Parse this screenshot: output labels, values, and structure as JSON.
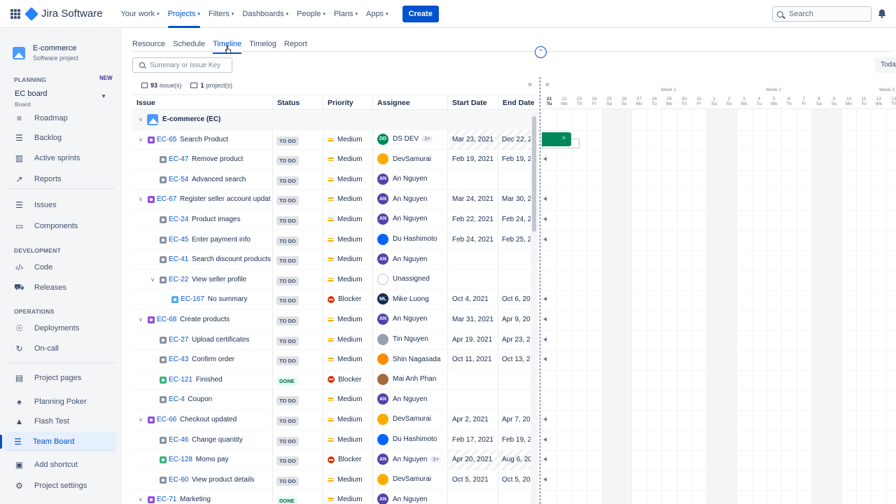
{
  "topnav": {
    "app_name": "Jira Software",
    "items": [
      {
        "label": "Your work",
        "active": false
      },
      {
        "label": "Projects",
        "active": true
      },
      {
        "label": "Filters",
        "active": false
      },
      {
        "label": "Dashboards",
        "active": false
      },
      {
        "label": "People",
        "active": false
      },
      {
        "label": "Plans",
        "active": false
      },
      {
        "label": "Apps",
        "active": false
      }
    ],
    "create_label": "Create",
    "search_placeholder": "Search"
  },
  "sidebar": {
    "project_name": "E-commerce",
    "project_type": "Software project",
    "planning_label": "PLANNING",
    "new_badge": "NEW",
    "board_name": "EC board",
    "board_sub": "Board",
    "planning_items": [
      "Roadmap",
      "Backlog",
      "Active sprints",
      "Reports"
    ],
    "other_items": [
      "Issues",
      "Components"
    ],
    "development_label": "DEVELOPMENT",
    "development_items": [
      "Code",
      "Releases"
    ],
    "operations_label": "OPERATIONS",
    "operations_items": [
      "Deployments",
      "On-call"
    ],
    "bottom_items": [
      "Project pages",
      "Planning Poker",
      "Flash Test",
      "Team Board"
    ],
    "active_item": "Team Board",
    "add_shortcut": "Add shortcut",
    "project_settings": "Project settings"
  },
  "tabs": [
    "Resource",
    "Schedule",
    "Timeline",
    "Timelog",
    "Report"
  ],
  "active_tab": "Timeline",
  "issue_search_placeholder": "Summary or Issue Key",
  "today_label": "Toda",
  "counts": {
    "issues": "93",
    "issues_label": "issue(s)",
    "projects": "1",
    "projects_label": "project(s)"
  },
  "columns": [
    "Issue",
    "Status",
    "Priority",
    "Assignee",
    "Start Date",
    "End Date"
  ],
  "rows": [
    {
      "type": "group",
      "key": "",
      "summary": "E-commerce",
      "suffix": "(EC)"
    },
    {
      "type": "epic",
      "level": 1,
      "caret": true,
      "key": "EC-65",
      "summary": "Search Product",
      "status": "TO DO",
      "priority": "Medium",
      "assignee": "DS DEV",
      "avatar": "DD",
      "avatar_color": "#00875a",
      "extra": "1+",
      "start": "Mar 23, 2021",
      "end": "Dec 22, 2",
      "hatch": true
    },
    {
      "type": "sub",
      "level": 2,
      "key": "EC-47",
      "summary": "Remove product",
      "status": "TO DO",
      "priority": "Medium",
      "assignee": "DevSamurai",
      "avatar": "",
      "avatar_color": "#ffab00",
      "start": "Feb 19, 2021",
      "end": "Feb 19, 2"
    },
    {
      "type": "sub",
      "level": 2,
      "key": "EC-54",
      "summary": "Advanced search",
      "status": "TO DO",
      "priority": "Medium",
      "assignee": "An Nguyen",
      "avatar": "AN",
      "avatar_color": "#5243aa",
      "start": "",
      "end": ""
    },
    {
      "type": "epic",
      "level": 1,
      "caret": true,
      "key": "EC-67",
      "summary": "Register seller account update",
      "status": "TO DO",
      "priority": "Medium",
      "assignee": "An Nguyen",
      "avatar": "AN",
      "avatar_color": "#5243aa",
      "start": "Mar 24, 2021",
      "end": "Mar 30, 2"
    },
    {
      "type": "sub",
      "level": 2,
      "key": "EC-24",
      "summary": "Product images",
      "status": "TO DO",
      "priority": "Medium",
      "assignee": "An Nguyen",
      "avatar": "AN",
      "avatar_color": "#5243aa",
      "start": "Feb 22, 2021",
      "end": "Feb 24, 2"
    },
    {
      "type": "sub",
      "level": 2,
      "key": "EC-45",
      "summary": "Enter payment info",
      "status": "TO DO",
      "priority": "Medium",
      "assignee": "Du Hashimoto",
      "avatar": "",
      "avatar_color": "#0065ff",
      "start": "Feb 24, 2021",
      "end": "Feb 25, 2"
    },
    {
      "type": "sub",
      "level": 2,
      "key": "EC-41",
      "summary": "Search discount products",
      "status": "TO DO",
      "priority": "Medium",
      "assignee": "An Nguyen",
      "avatar": "AN",
      "avatar_color": "#5243aa",
      "start": "",
      "end": ""
    },
    {
      "type": "sub",
      "level": 2,
      "caret": true,
      "key": "EC-22",
      "summary": "View seller profile",
      "status": "TO DO",
      "priority": "Medium",
      "assignee": "Unassigned",
      "avatar": "",
      "avatar_color": "#dfe1e6",
      "start": "",
      "end": ""
    },
    {
      "type": "task",
      "level": 3,
      "key": "EC-167",
      "summary": "No summary",
      "status": "TO DO",
      "priority": "Blocker",
      "assignee": "Mike Luong",
      "avatar": "ML",
      "avatar_color": "#172b4d",
      "start": "Oct 4, 2021",
      "end": "Oct 6, 20"
    },
    {
      "type": "epic",
      "level": 1,
      "caret": true,
      "key": "EC-68",
      "summary": "Create products",
      "status": "TO DO",
      "priority": "Medium",
      "assignee": "An Nguyen",
      "avatar": "AN",
      "avatar_color": "#5243aa",
      "start": "Mar 31, 2021",
      "end": "Apr 9, 20"
    },
    {
      "type": "sub",
      "level": 2,
      "key": "EC-27",
      "summary": "Upload certificates",
      "status": "TO DO",
      "priority": "Medium",
      "assignee": "Tin Nguyen",
      "avatar": "",
      "avatar_color": "#97a0af",
      "start": "Apr 19, 2021",
      "end": "Apr 23, 2"
    },
    {
      "type": "sub",
      "level": 2,
      "key": "EC-43",
      "summary": "Confirm order",
      "status": "TO DO",
      "priority": "Medium",
      "assignee": "Shin Nagasada",
      "avatar": "",
      "avatar_color": "#ff8b00",
      "start": "Oct 11, 2021",
      "end": "Oct 13, 2"
    },
    {
      "type": "story",
      "level": 2,
      "key": "EC-121",
      "summary": "Finished",
      "status": "DONE",
      "priority": "Blocker",
      "assignee": "Mai Anh Phan",
      "avatar": "",
      "avatar_color": "#a5673f",
      "start": "",
      "end": ""
    },
    {
      "type": "sub",
      "level": 2,
      "key": "EC-4",
      "summary": "Coupon",
      "status": "TO DO",
      "priority": "Medium",
      "assignee": "An Nguyen",
      "avatar": "AN",
      "avatar_color": "#5243aa",
      "start": "",
      "end": ""
    },
    {
      "type": "epic",
      "level": 1,
      "caret": true,
      "key": "EC-66",
      "summary": "Checkout updated",
      "status": "TO DO",
      "priority": "Medium",
      "assignee": "DevSamurai",
      "avatar": "",
      "avatar_color": "#ffab00",
      "start": "Apr 2, 2021",
      "end": "Apr 7, 20"
    },
    {
      "type": "sub",
      "level": 2,
      "key": "EC-46",
      "summary": "Change quantity",
      "status": "TO DO",
      "priority": "Medium",
      "assignee": "Du Hashimoto",
      "avatar": "",
      "avatar_color": "#0065ff",
      "start": "Feb 17, 2021",
      "end": "Feb 19, 2"
    },
    {
      "type": "story",
      "level": 2,
      "key": "EC-128",
      "summary": "Momo pay",
      "status": "TO DO",
      "priority": "Blocker",
      "assignee": "An Nguyen",
      "avatar": "AN",
      "avatar_color": "#5243aa",
      "extra": "1+",
      "start": "Apr 20, 2021",
      "end": "Aug 6, 20",
      "hatch": true
    },
    {
      "type": "sub",
      "level": 2,
      "key": "EC-60",
      "summary": "View product details",
      "status": "TO DO",
      "priority": "Medium",
      "assignee": "DevSamurai",
      "avatar": "",
      "avatar_color": "#ffab00",
      "start": "Oct 5, 2021",
      "end": "Oct 5, 20"
    },
    {
      "type": "epic",
      "level": 1,
      "caret": true,
      "key": "EC-71",
      "summary": "Marketing",
      "status": "DONE",
      "priority": "Medium",
      "assignee": "An Nguyen",
      "avatar": "AN",
      "avatar_color": "#5243aa",
      "start": "",
      "end": ""
    }
  ],
  "timeline": {
    "weeks": [
      "Week 1",
      "Week 2",
      "Week 3"
    ],
    "days": [
      {
        "d": "21",
        "w": "Tu"
      },
      {
        "d": "22",
        "w": "We"
      },
      {
        "d": "23",
        "w": "Th"
      },
      {
        "d": "24",
        "w": "Fr"
      },
      {
        "d": "25",
        "w": "Sa"
      },
      {
        "d": "26",
        "w": "Su"
      },
      {
        "d": "27",
        "w": "Mo"
      },
      {
        "d": "28",
        "w": "Tu"
      },
      {
        "d": "29",
        "w": "We"
      },
      {
        "d": "30",
        "w": "Th"
      },
      {
        "d": "31",
        "w": "Fr"
      },
      {
        "d": "1",
        "w": "Sa"
      },
      {
        "d": "2",
        "w": "Su"
      },
      {
        "d": "3",
        "w": "Mo"
      },
      {
        "d": "4",
        "w": "Tu"
      },
      {
        "d": "5",
        "w": "We"
      },
      {
        "d": "6",
        "w": "Th"
      },
      {
        "d": "7",
        "w": "Fr"
      },
      {
        "d": "8",
        "w": "Sa"
      },
      {
        "d": "9",
        "w": "Su"
      },
      {
        "d": "10",
        "w": "Mo"
      },
      {
        "d": "11",
        "w": "Tu"
      },
      {
        "d": "12",
        "w": "We"
      },
      {
        "d": "13",
        "w": "Th"
      }
    ],
    "bar_label": ">"
  }
}
